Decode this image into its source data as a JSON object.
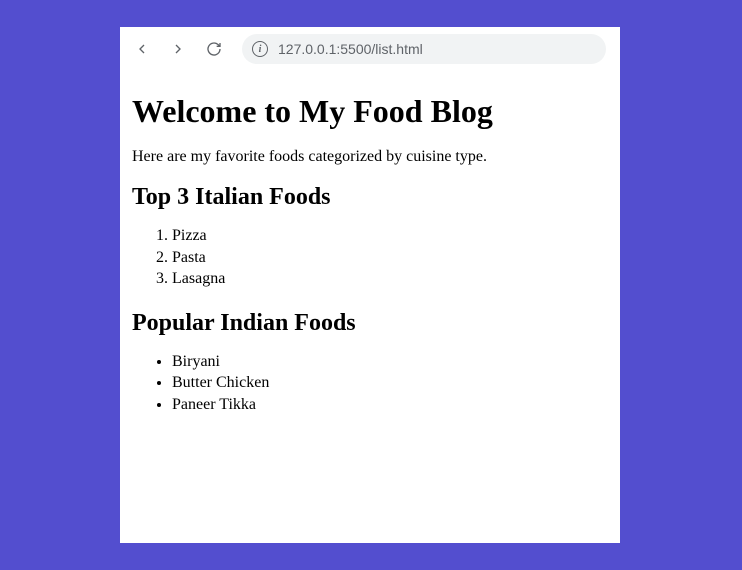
{
  "toolbar": {
    "url": "127.0.0.1:5500/list.html"
  },
  "page": {
    "h1": "Welcome to My Food Blog",
    "intro": "Here are my favorite foods categorized by cuisine type.",
    "sections": [
      {
        "heading": "Top 3 Italian Foods",
        "type": "ordered",
        "items": [
          "Pizza",
          "Pasta",
          "Lasagna"
        ]
      },
      {
        "heading": "Popular Indian Foods",
        "type": "unordered",
        "items": [
          "Biryani",
          "Butter Chicken",
          "Paneer Tikka"
        ]
      }
    ]
  }
}
